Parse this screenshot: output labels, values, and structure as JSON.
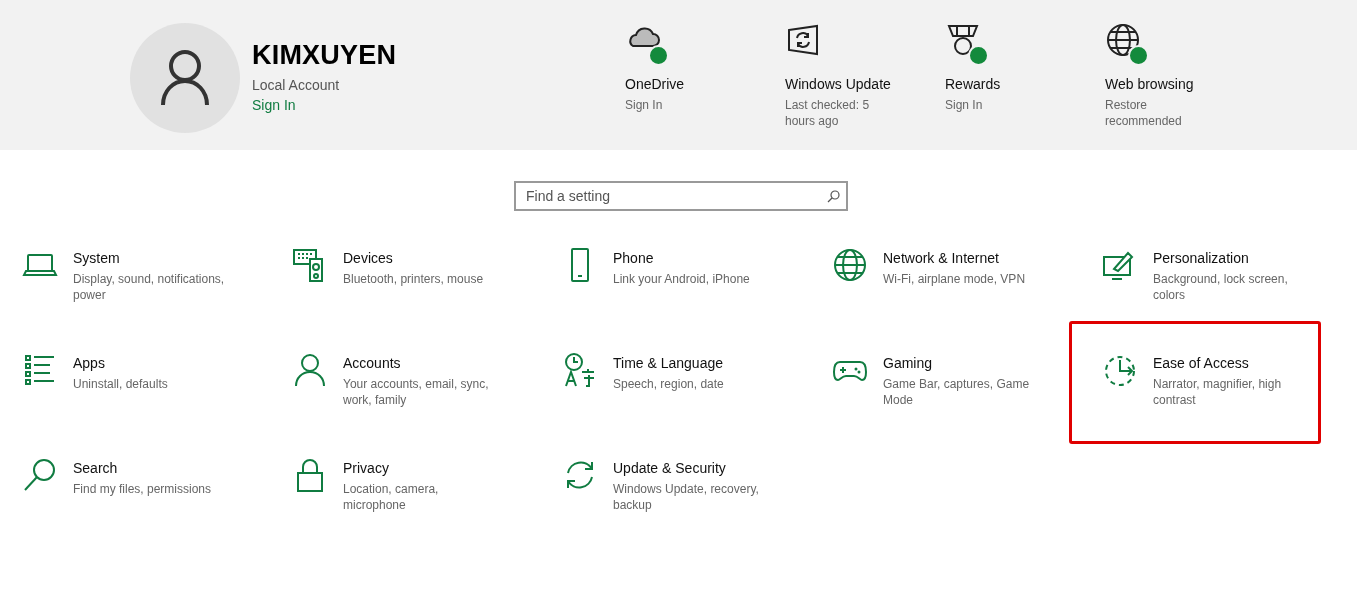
{
  "account": {
    "name": "KIMXUYEN",
    "type": "Local Account",
    "link": "Sign In"
  },
  "status_items": [
    {
      "kind": "cloud",
      "title": "OneDrive",
      "subtitle": "Sign In",
      "badge": true
    },
    {
      "kind": "update",
      "title": "Windows Update",
      "subtitle": "Last checked: 5 hours ago",
      "badge": false
    },
    {
      "kind": "medal",
      "title": "Rewards",
      "subtitle": "Sign In",
      "badge": true
    },
    {
      "kind": "globe",
      "title": "Web browsing",
      "subtitle": "Restore recommended",
      "badge": true
    }
  ],
  "search": {
    "placeholder": "Find a setting"
  },
  "categories": [
    {
      "kind": "laptop",
      "title": "System",
      "description": "Display, sound, notifications, power",
      "highlighted": false
    },
    {
      "kind": "keyboard",
      "title": "Devices",
      "description": "Bluetooth, printers, mouse",
      "highlighted": false
    },
    {
      "kind": "phone",
      "title": "Phone",
      "description": "Link your Android, iPhone",
      "highlighted": false
    },
    {
      "kind": "globe",
      "title": "Network & Internet",
      "description": "Wi-Fi, airplane mode, VPN",
      "highlighted": false
    },
    {
      "kind": "paint",
      "title": "Personalization",
      "description": "Background, lock screen, colors",
      "highlighted": false
    },
    {
      "kind": "list",
      "title": "Apps",
      "description": "Uninstall, defaults",
      "highlighted": false
    },
    {
      "kind": "person",
      "title": "Accounts",
      "description": "Your accounts, email, sync, work, family",
      "highlighted": false
    },
    {
      "kind": "language",
      "title": "Time & Language",
      "description": "Speech, region, date",
      "highlighted": false
    },
    {
      "kind": "gamepad",
      "title": "Gaming",
      "description": "Game Bar, captures, Game Mode",
      "highlighted": false
    },
    {
      "kind": "access",
      "title": "Ease of Access",
      "description": "Narrator, magnifier, high contrast",
      "highlighted": true
    },
    {
      "kind": "search",
      "title": "Search",
      "description": "Find my files, permissions",
      "highlighted": false
    },
    {
      "kind": "lock",
      "title": "Privacy",
      "description": "Location, camera, microphone",
      "highlighted": false
    },
    {
      "kind": "sync",
      "title": "Update & Security",
      "description": "Windows Update, recovery, backup",
      "highlighted": false
    }
  ]
}
